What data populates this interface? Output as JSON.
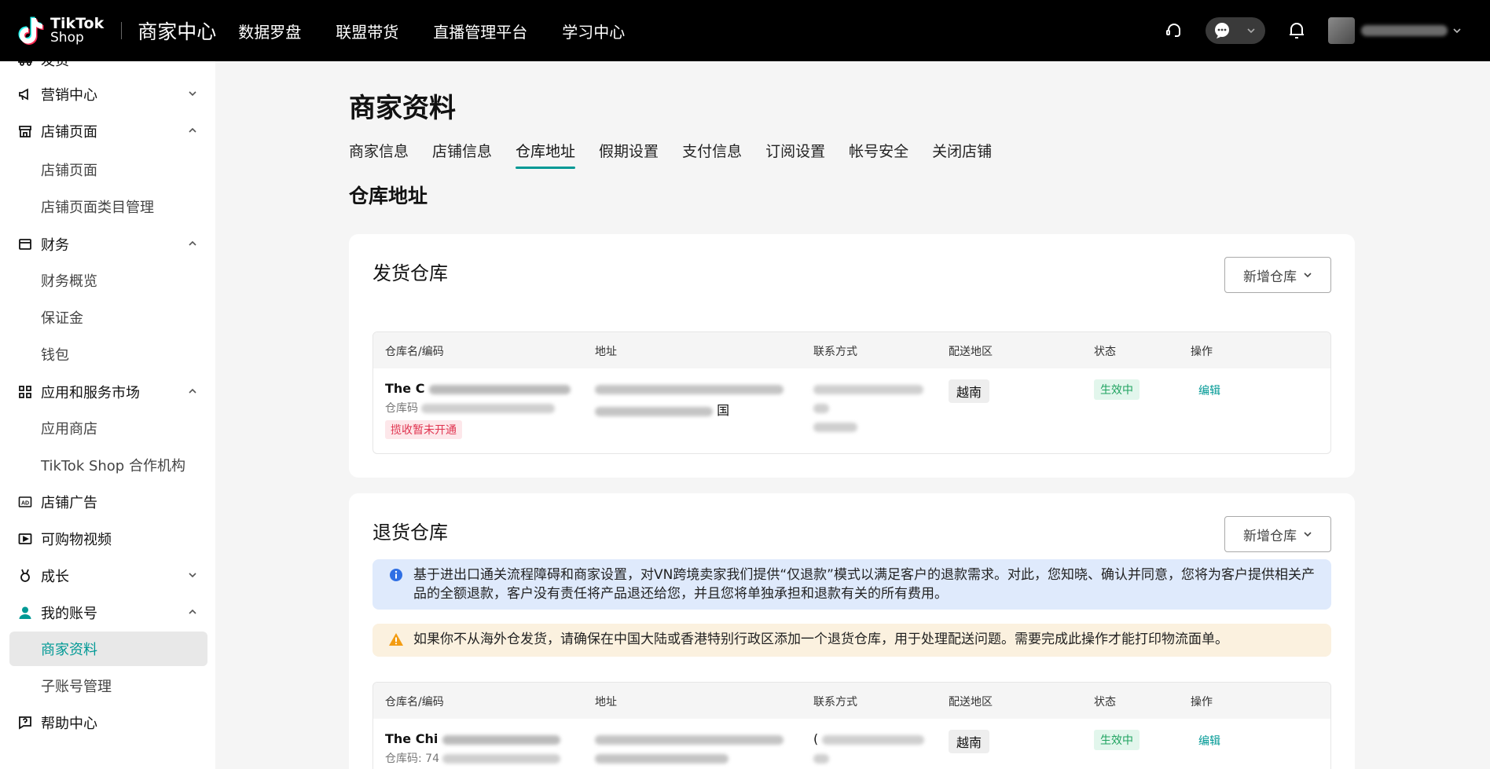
{
  "topbar": {
    "logo_line1": "TikTok",
    "logo_line2": "Shop",
    "center_title": "商家中心",
    "nav": [
      "数据罗盘",
      "联盟带货",
      "直播管理平台",
      "学习中心"
    ]
  },
  "sidebar": {
    "top_partial_label": "发货",
    "items": [
      {
        "label": "营销中心",
        "icon": "megaphone-icon",
        "expanded": false
      },
      {
        "label": "店铺页面",
        "icon": "store-icon",
        "expanded": true
      },
      {
        "label": "店铺页面",
        "sub": true
      },
      {
        "label": "店铺页面类目管理",
        "sub": true
      },
      {
        "label": "财务",
        "icon": "wallet-icon",
        "expanded": true
      },
      {
        "label": "财务概览",
        "sub": true
      },
      {
        "label": "保证金",
        "sub": true
      },
      {
        "label": "钱包",
        "sub": true
      },
      {
        "label": "应用和服务市场",
        "icon": "apps-icon",
        "expanded": true
      },
      {
        "label": "应用商店",
        "sub": true
      },
      {
        "label": "TikTok Shop 合作机构",
        "sub": true
      },
      {
        "label": "店铺广告",
        "icon": "ad-icon"
      },
      {
        "label": "可购物视频",
        "icon": "video-icon"
      },
      {
        "label": "成长",
        "icon": "medal-icon",
        "expanded": false
      },
      {
        "label": "我的账号",
        "icon": "user-icon",
        "expanded": true
      },
      {
        "label": "商家资料",
        "sub": true,
        "active": true
      },
      {
        "label": "子账号管理",
        "sub": true
      },
      {
        "label": "帮助中心",
        "icon": "help-icon"
      }
    ]
  },
  "main": {
    "page_title": "商家资料",
    "tabs": [
      "商家信息",
      "店铺信息",
      "仓库地址",
      "假期设置",
      "支付信息",
      "订阅设置",
      "帐号安全",
      "关闭店铺"
    ],
    "active_tab": "仓库地址",
    "section_title": "仓库地址",
    "table_headers": [
      "仓库名/编码",
      "地址",
      "联系方式",
      "配送地区",
      "状态",
      "操作"
    ],
    "ship_card": {
      "title": "发货仓库",
      "add_button": "新增仓库",
      "row": {
        "name": "The C",
        "code_label": "仓库码",
        "address_line2_tail": "国",
        "pickup_tag": "揽收暂未开通",
        "region": "越南",
        "status": "生效中",
        "action": "编辑"
      }
    },
    "return_card": {
      "title": "退货仓库",
      "add_button": "新增仓库",
      "info_notice": "基于进出口通关流程障碍和商家设置，对VN跨境卖家我们提供“仅退款”模式以满足客户的退款需求。对此，您知晓、确认并同意，您将为客户提供相关产品的全额退款，客户没有责任将产品退还给您，并且您将单独承担和退款有关的所有费用。",
      "warn_notice": "如果你不从海外仓发货，请确保在中国大陆或香港特别行政区添加一个退货仓库，用于处理配送问题。需要完成此操作才能打印物流面单。",
      "row": {
        "name": "The Chi",
        "code_label": "仓库码: 74",
        "contact_prefix": "(",
        "region": "越南",
        "status": "生效中",
        "action": "编辑"
      }
    }
  },
  "colors": {
    "accent": "#009995",
    "topbar_bg": "#000000",
    "status_green": "#1fa35f",
    "tag_red": "#e0334f",
    "info_bg": "#dfeafc",
    "warn_bg": "#fbf1df"
  }
}
